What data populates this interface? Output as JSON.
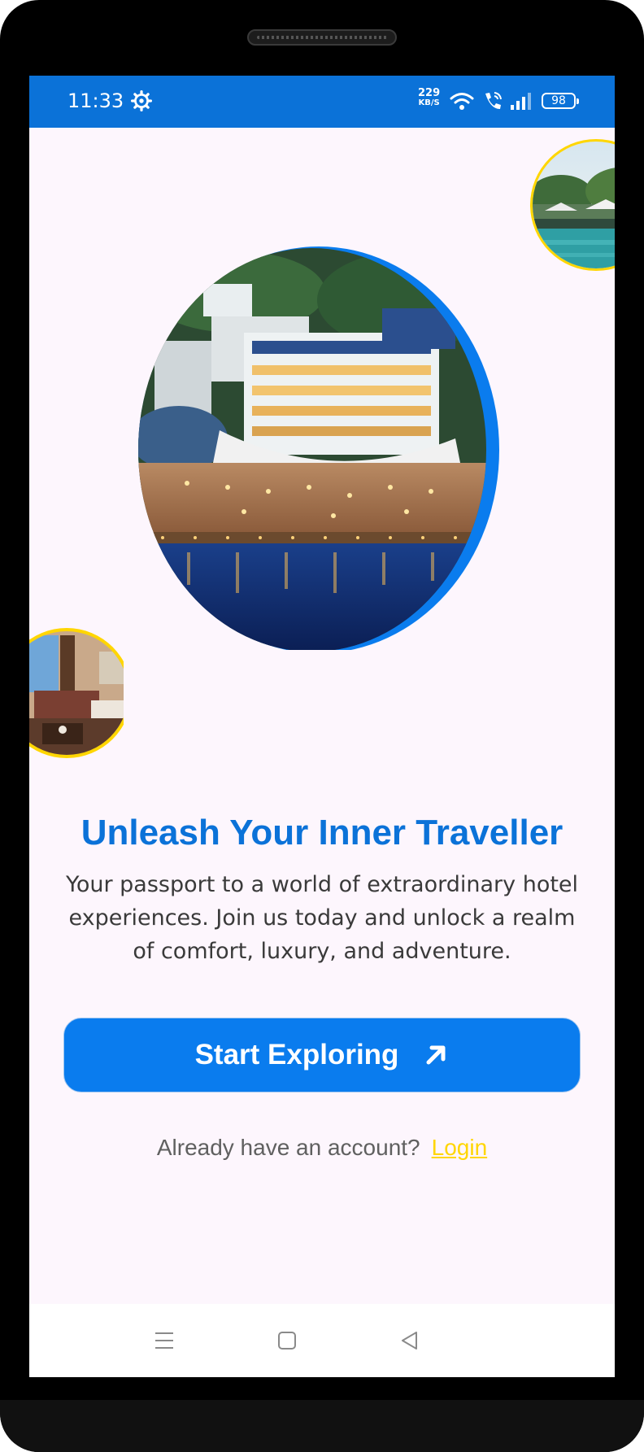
{
  "status_bar": {
    "time": "11:33",
    "net_speed_value": "229",
    "net_speed_unit": "KB/S",
    "battery": "98",
    "icons": [
      "gear-icon",
      "wifi-icon",
      "wifi-call-icon",
      "signal-icon",
      "battery-icon"
    ]
  },
  "hero": {
    "headline": "Unleash Your Inner Traveller",
    "description": "Your passport to a world of extraordinary hotel experiences. Join us today and unlock a realm of comfort, luxury, and adventure."
  },
  "cta": {
    "label": "Start Exploring",
    "icon": "arrow-up-right-icon"
  },
  "login": {
    "prompt": "Already have an account?",
    "link": "Login"
  },
  "nav_bar": {
    "icons": [
      "menu-icon",
      "home-icon",
      "back-icon"
    ]
  },
  "colors": {
    "primary": "#0b72d8",
    "button": "#0a7cee",
    "accent": "#ffd600",
    "background": "#fdf6fd"
  }
}
